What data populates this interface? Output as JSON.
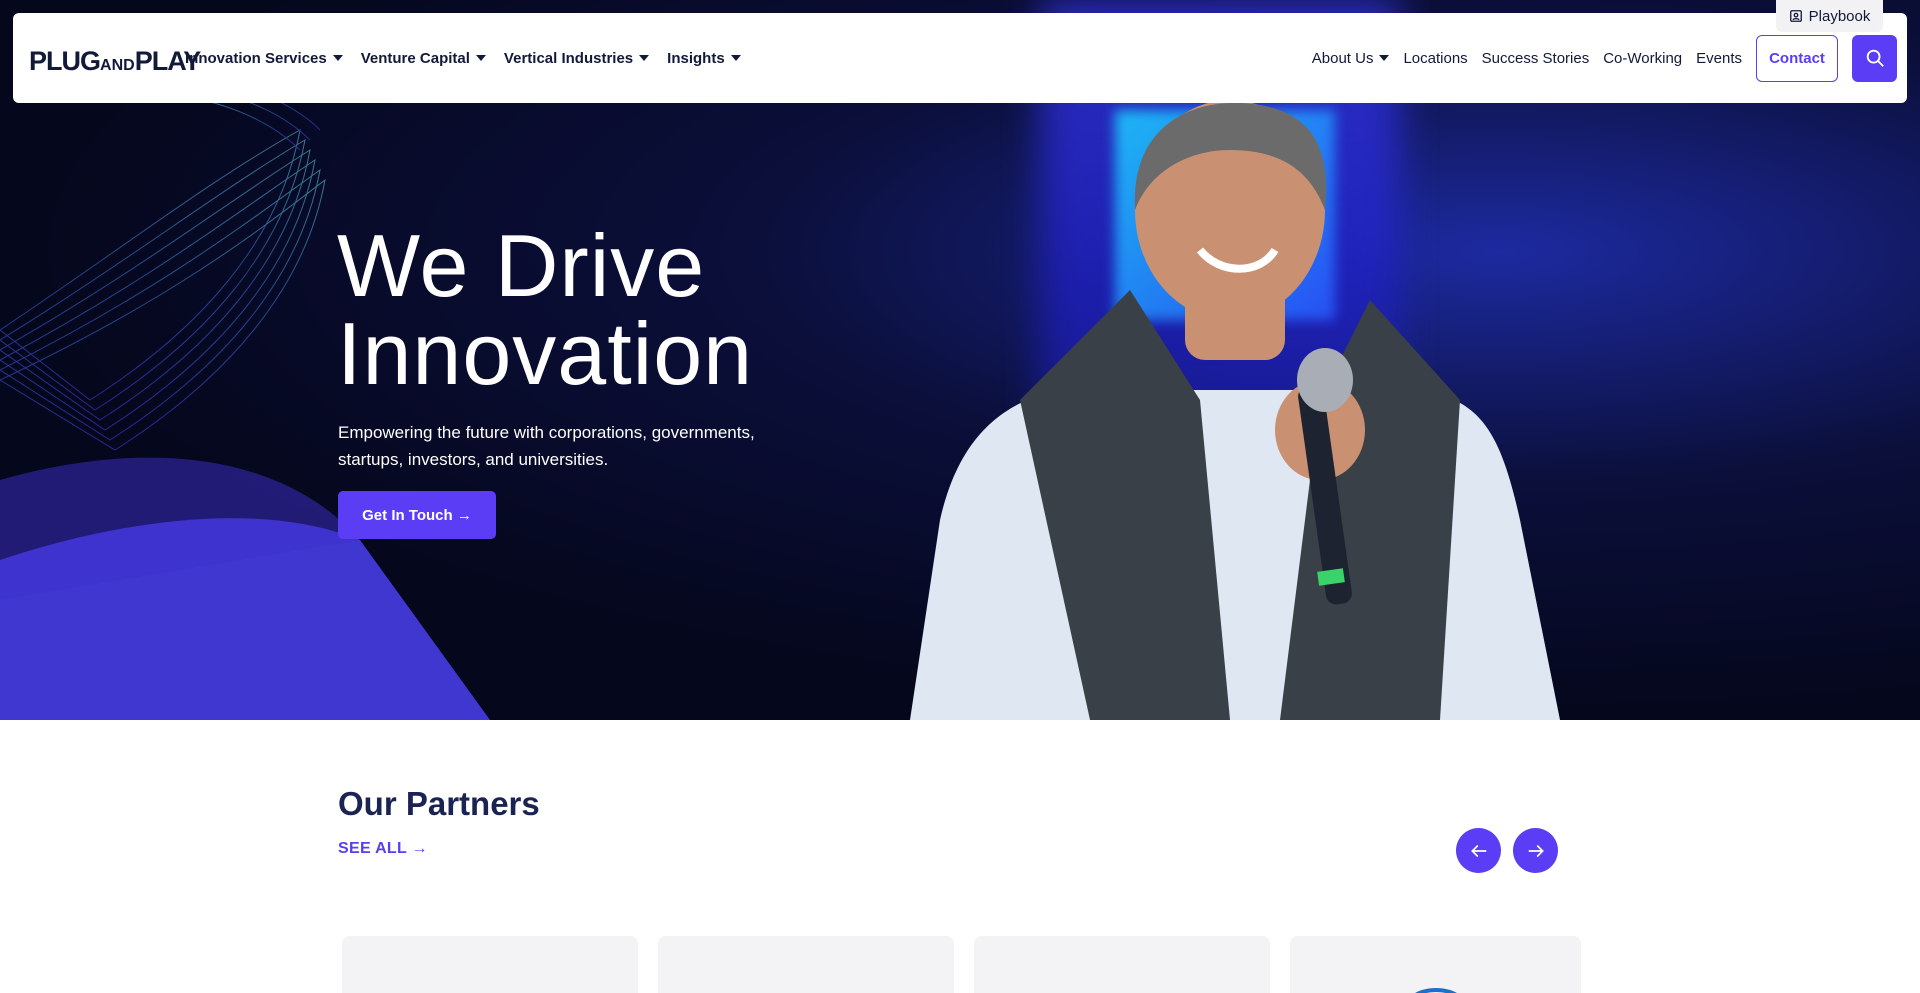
{
  "topbar": {
    "playbook_label": "Playbook"
  },
  "nav": {
    "logo_main": "PLUG",
    "logo_and": "AND",
    "logo_play": "PLAY",
    "left_items": [
      {
        "label": "Innovation Services"
      },
      {
        "label": "Venture Capital"
      },
      {
        "label": "Vertical Industries"
      },
      {
        "label": "Insights"
      }
    ],
    "right_items": [
      {
        "label": "About Us"
      },
      {
        "label": "Locations"
      },
      {
        "label": "Success Stories"
      },
      {
        "label": "Co-Working"
      },
      {
        "label": "Events"
      }
    ],
    "contact_label": "Contact",
    "search_icon": "search-icon"
  },
  "hero": {
    "title_line1": "We Drive",
    "title_line2": "Innovation",
    "subtitle_line1": "Empowering the future with corporations, governments,",
    "subtitle_line2": "startups, investors, and universities.",
    "cta_label": "Get In Touch →"
  },
  "partners": {
    "title": "Our Partners",
    "see_all_label": "SEE ALL →",
    "prev_icon": "arrow-left-icon",
    "next_icon": "arrow-right-icon"
  },
  "colors": {
    "accent": "#5b3df5",
    "navy": "#121a3a",
    "hero_bg": "#05071c"
  }
}
